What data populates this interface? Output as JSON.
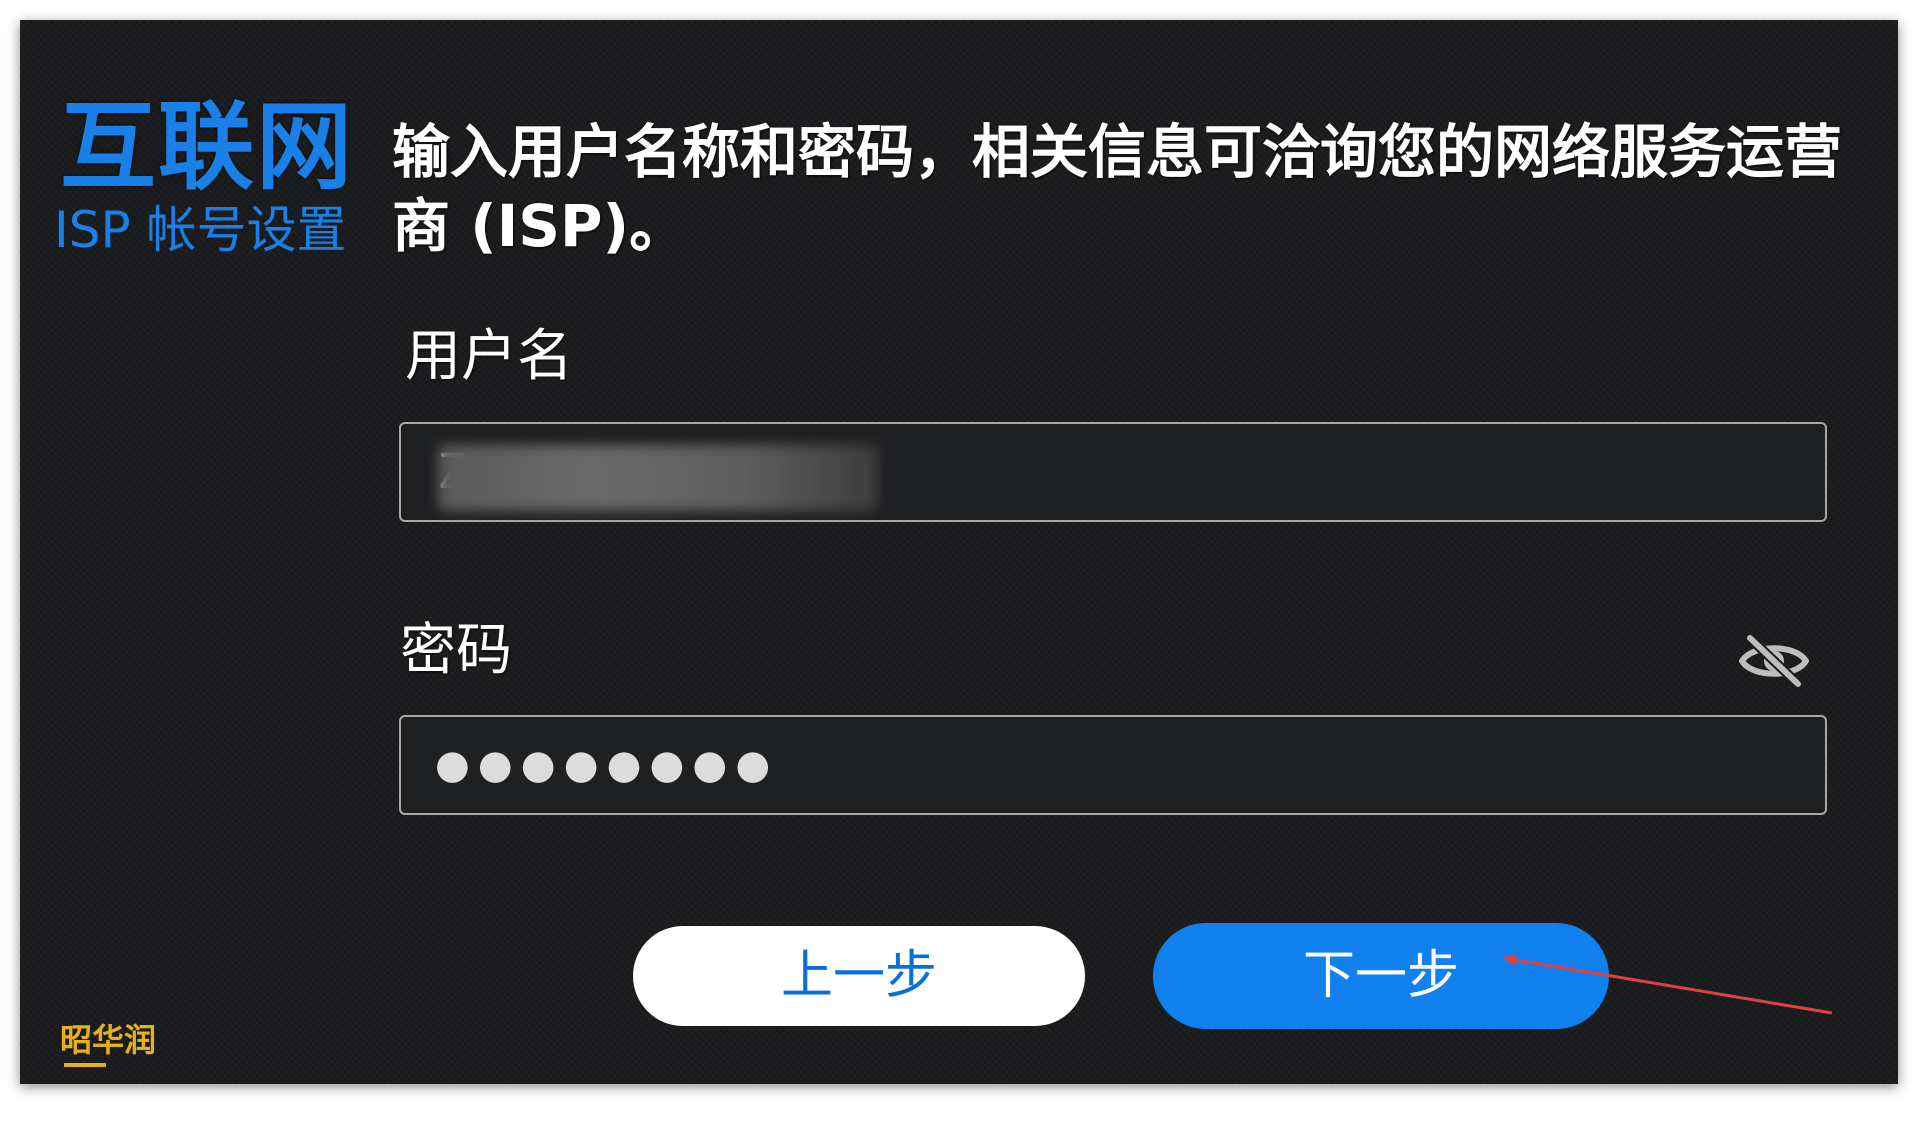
{
  "sidebar": {
    "title": "互联网",
    "subtitle": "ISP 帐号设置"
  },
  "instruction": "输入用户名称和密码，相关信息可洽询您的网络服务运营商 (ISP)。",
  "form": {
    "username_label": "用户名",
    "username_value": "Z",
    "password_label": "密码",
    "password_masked": "●●●●●●●●",
    "password_visibility_icon": "eye-slash-icon"
  },
  "buttons": {
    "back_label": "上一步",
    "next_label": "下一步"
  },
  "annotation": {
    "arrow_color": "#e0403f"
  },
  "watermark": {
    "text": "昭华润"
  },
  "colors": {
    "accent": "#1181f0",
    "title_blue": "#1a7fe6",
    "background": "#1b1c1e"
  }
}
